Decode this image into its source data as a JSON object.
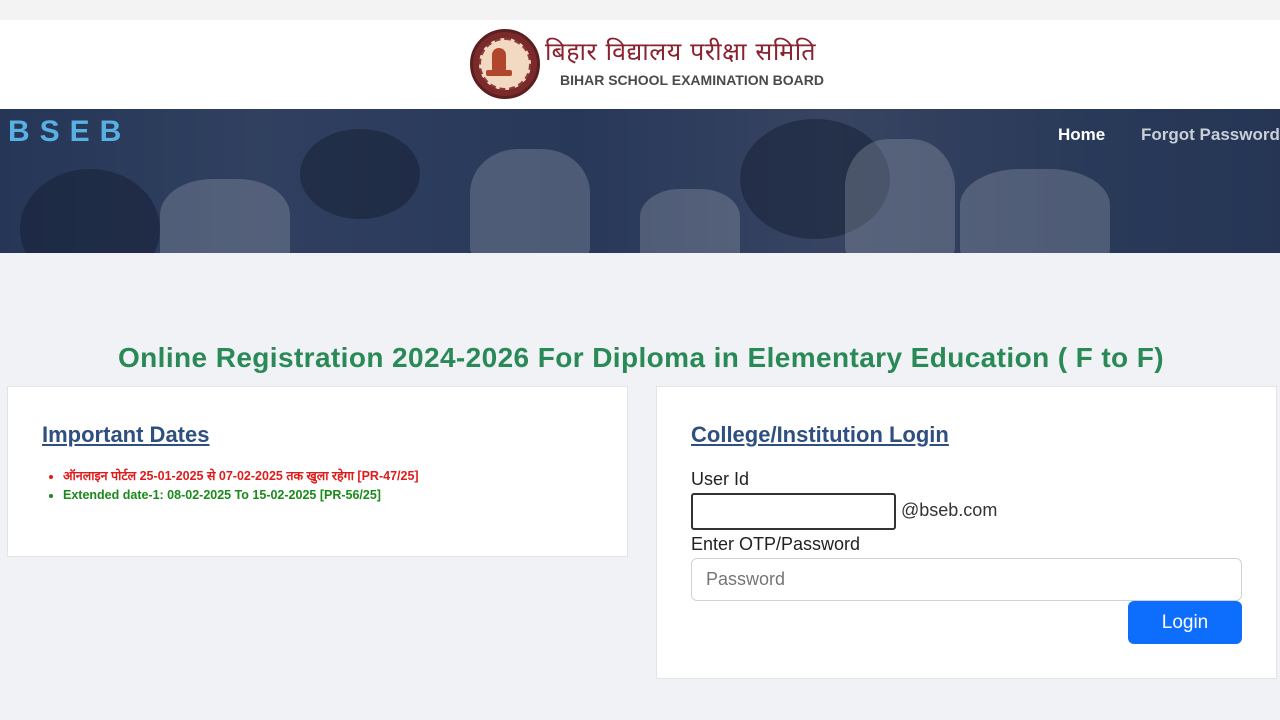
{
  "header": {
    "title_hindi": "बिहार विद्यालय परीक्षा समिति",
    "title_english": "BIHAR SCHOOL EXAMINATION BOARD",
    "logo_icon": "bseb-emblem-icon"
  },
  "navbar": {
    "brand": "BSEB",
    "links": [
      {
        "label": "Home"
      },
      {
        "label": "Forgot Password"
      }
    ]
  },
  "page": {
    "title": "Online Registration 2024-2026 For Diploma in Elementary Education ( F to F)"
  },
  "important_dates": {
    "heading": "Important Dates",
    "items": [
      {
        "text": "ऑनलाइन पोर्टल 25-01-2025 से 07-02-2025 तक खुला रहेगा [PR-47/25]",
        "color": "#e01b1b"
      },
      {
        "text": "Extended date-1: 08-02-2025 To 15-02-2025 [PR-56/25]",
        "color": "#1a8a1a"
      }
    ]
  },
  "login": {
    "heading": "College/Institution Login",
    "user_id_label": "User Id",
    "user_id_value": "",
    "domain_suffix": "@bseb.com",
    "password_label": "Enter OTP/Password",
    "password_placeholder": "Password",
    "button_label": "Login"
  },
  "colors": {
    "accent_green": "#2a8a57",
    "heading_blue": "#2e4f7f",
    "button_blue": "#0d6efd",
    "brand_blue": "#59b0e3"
  }
}
